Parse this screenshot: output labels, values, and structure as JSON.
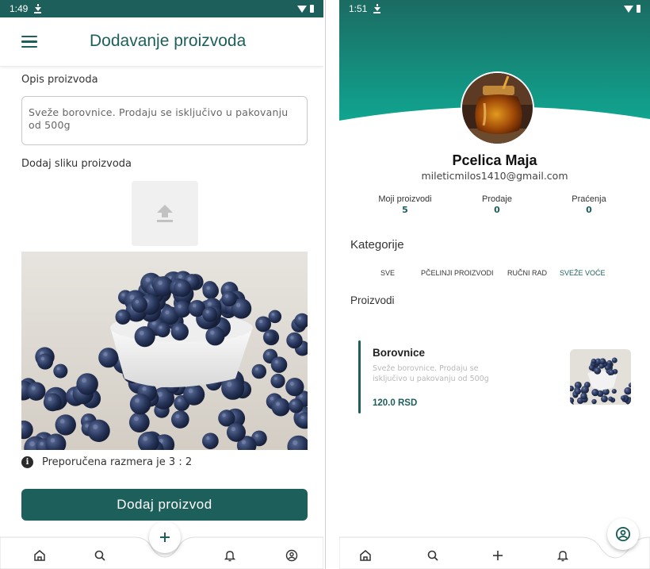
{
  "left_screen": {
    "status": {
      "time": "1:49"
    },
    "appbar": {
      "title": "Dodavanje proizvoda"
    },
    "form": {
      "description_label": "Opis proizvoda",
      "description_value": "Sveže borovnice. Prodaju se isključivo u pakovanju od 500g",
      "image_label": "Dodaj sliku proizvoda",
      "ratio_hint": "Preporučena razmera je 3 : 2",
      "submit_label": "Dodaj proizvod"
    },
    "nav": {
      "items": [
        {
          "icon": "home-icon"
        },
        {
          "icon": "search-icon"
        },
        {
          "icon": "plus-icon",
          "active": true
        },
        {
          "icon": "bell-icon"
        },
        {
          "icon": "profile-icon"
        }
      ]
    }
  },
  "right_screen": {
    "status": {
      "time": "1:51"
    },
    "profile": {
      "name": "Pcelica Maja",
      "email": "mileticmilos1410@gmail.com",
      "stats": [
        {
          "label": "Moji proizvodi",
          "value": "5"
        },
        {
          "label": "Prodaje",
          "value": "0"
        },
        {
          "label": "Praćenja",
          "value": "0"
        }
      ]
    },
    "categories": {
      "title": "Kategorije",
      "items": [
        {
          "label": "SVE",
          "active": false
        },
        {
          "label": "PČELINJI PROIZVODI",
          "active": false
        },
        {
          "label": "RUČNI RAD",
          "active": false
        },
        {
          "label": "SVEŽE VOĆE",
          "active": true
        }
      ]
    },
    "products": {
      "title": "Proizvodi",
      "items": [
        {
          "name": "Borovnice",
          "description": "Sveže borovnice. Prodaju se isključivo u pakovanju od 500g",
          "price": "120.0 RSD"
        }
      ]
    },
    "nav": {
      "items": [
        {
          "icon": "home-icon"
        },
        {
          "icon": "search-icon"
        },
        {
          "icon": "plus-icon"
        },
        {
          "icon": "bell-icon"
        },
        {
          "icon": "profile-icon",
          "active": true
        }
      ]
    }
  },
  "colors": {
    "primary": "#1d5f5b",
    "gradient_top": "#1b6b62",
    "gradient_bottom": "#10a590"
  }
}
